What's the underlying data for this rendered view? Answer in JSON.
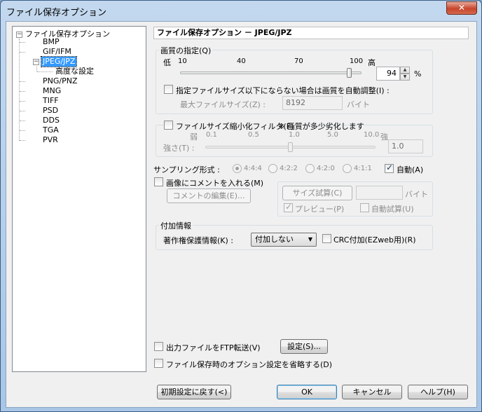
{
  "window": {
    "title": "ファイル保存オプション",
    "close_label": "✕"
  },
  "tree": {
    "root": "ファイル保存オプション",
    "items": [
      "BMP",
      "GIF/IFM",
      "JPEG/JPZ",
      "高度な設定",
      "PNG/PNZ",
      "MNG",
      "TIFF",
      "PSD",
      "DDS",
      "TGA",
      "PVR"
    ],
    "selected": "JPEG/JPZ"
  },
  "panel": {
    "header": "ファイル保存オプション － JPEG/JPZ",
    "quality": {
      "group_label": "画質の指定(Q)",
      "low": "低",
      "high": "高",
      "ticks": [
        "10",
        "40",
        "70",
        "100"
      ],
      "value": "94",
      "percent": "%",
      "slider_value": 94,
      "auto_adjust_label": "指定ファイルサイズ以下にならない場合は画質を自動調整(I) :",
      "max_size_label": "最大ファイルサイズ(Z) :",
      "max_size_value": "8192",
      "max_size_unit": "バイト"
    },
    "filter": {
      "checkbox_label": "ファイルサイズ縮小化フィルタ(F)",
      "note": "※ 画質が多少劣化します",
      "weak": "弱",
      "strong": "強",
      "ticks": [
        "0.1",
        "0.5",
        "1.0",
        "5.0",
        "10.0"
      ],
      "strength_label": "強さ(T) :",
      "strength_value": "1.0",
      "slider_value": 1.0
    },
    "sampling": {
      "label": "サンプリング形式 :",
      "options": [
        "4:4:4",
        "4:2:2",
        "4:2:0",
        "4:1:1"
      ],
      "selected": "4:4:4",
      "auto_label": "自動(A)",
      "auto_checked": true
    },
    "comment": {
      "checkbox_label": "画像にコメントを入れる(M)",
      "edit_button": "コメントの編集(E)..."
    },
    "size_test": {
      "button": "サイズ試算(C)",
      "unit": "バイト",
      "preview_label": "プレビュー(P)",
      "preview_checked": true,
      "auto_label": "自動試算(U)"
    },
    "extra": {
      "group_label": "付加情報",
      "copyright_label": "著作権保護情報(K) :",
      "copyright_value": "付加しない",
      "crc_label": "CRC付加(EZweb用)(R)"
    },
    "ftp_label": "出力ファイルをFTP転送(V)",
    "ftp_settings_button": "設定(S)...",
    "omit_label": "ファイル保存時のオプション設定を省略する(D)"
  },
  "buttons": {
    "reset": "初期設定に戻す(<)",
    "ok": "OK",
    "cancel": "キャンセル",
    "help": "ヘルプ(H)"
  }
}
